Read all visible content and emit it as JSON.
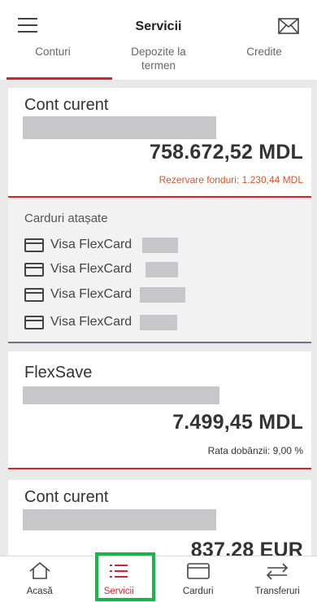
{
  "header": {
    "title": "Servicii"
  },
  "tabs": [
    {
      "label": "Conturi"
    },
    {
      "label": "Depozite la\ntermen"
    },
    {
      "label": "Credite"
    }
  ],
  "accounts": [
    {
      "name": "Cont curent",
      "balance": "758.672,52 MDL",
      "reserved_text": "Rezervare fonduri: 1.230,44 MDL",
      "linked_cards_title": "Carduri atașate",
      "cards": [
        {
          "label": "Visa FlexCard"
        },
        {
          "label": "Visa FlexCard"
        },
        {
          "label": "Visa FlexCard"
        },
        {
          "label": "Visa FlexCard"
        }
      ]
    },
    {
      "name": "FlexSave",
      "balance": "7.499,45 MDL",
      "rate_text": "Rata dobânzii: 9,00 %"
    },
    {
      "name": "Cont curent",
      "balance": "837,28 EUR"
    }
  ],
  "bottom_nav": [
    {
      "label": "Acasă",
      "icon": "home-icon"
    },
    {
      "label": "Servicii",
      "icon": "list-icon",
      "active": true
    },
    {
      "label": "Carduri",
      "icon": "card-icon"
    },
    {
      "label": "Transferuri",
      "icon": "transfer-icon"
    }
  ],
  "colors": {
    "accent": "#d8222f",
    "highlight": "#19b54a",
    "mask": "#c7c7c9"
  }
}
